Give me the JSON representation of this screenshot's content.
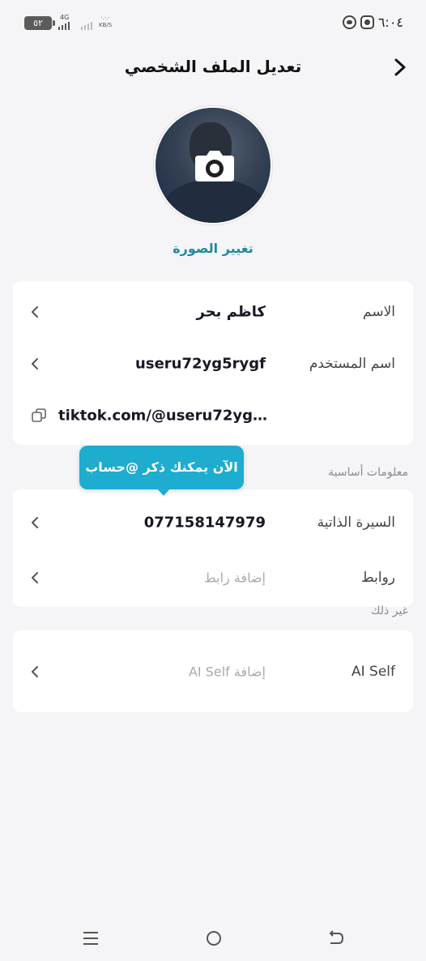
{
  "status_bar": {
    "battery": "٥٢",
    "network": "4G",
    "speed_top": "·.·.·",
    "speed_unit": "KB/S",
    "time": "٦:٠٤"
  },
  "header": {
    "title": "تعديل الملف الشخصي"
  },
  "photo": {
    "change_label": "تغيير الصورة"
  },
  "profile": {
    "name_label": "الاسم",
    "name_value": "كاظم بحر",
    "username_label": "اسم المستخدم",
    "username_value": "useru72yg5rygf",
    "link_value": "tiktok.com/@useru72yg5..."
  },
  "tooltip": {
    "text": "الآن يمكنك ذكر @حساب"
  },
  "basic_info": {
    "section_title": "معلومات أساسية",
    "bio_label": "السيرة الذاتية",
    "bio_value": "07715814797‪9",
    "links_label": "روابط",
    "links_placeholder": "إضافة رابط"
  },
  "other": {
    "section_title": "غير ذلك",
    "ai_self_label": "AI Self",
    "ai_self_placeholder": "إضافة AI Self"
  },
  "colors": {
    "accent": "#1c8ba0",
    "tooltip": "#1eaccf",
    "background": "#f5f5f7"
  }
}
